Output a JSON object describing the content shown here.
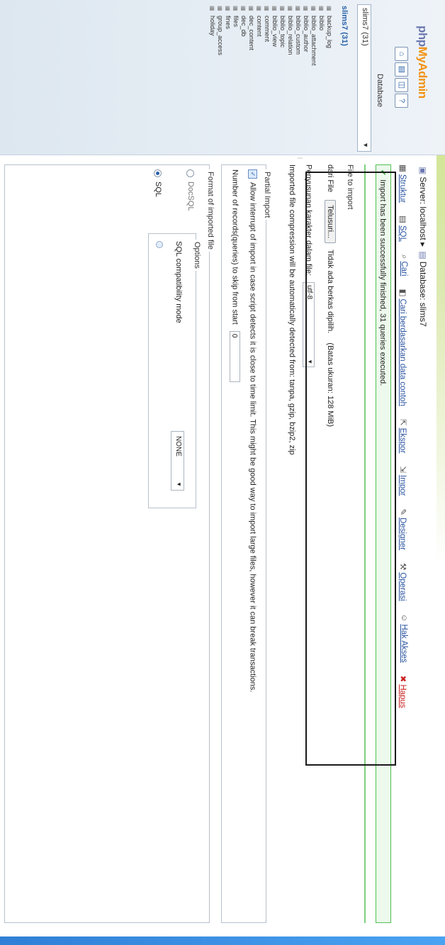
{
  "nav": {
    "logo": {
      "php": "php",
      "my": "My",
      "admin": "Admin"
    },
    "icons": [
      "home-icon",
      "sql-window-icon",
      "query-icon",
      "docs-icon"
    ],
    "db_label": "Database",
    "db_select_value": "slims7 (31)",
    "db_name": "slims7 (31)",
    "tables": [
      "backup_log",
      "biblio",
      "biblio_attachment",
      "biblio_author",
      "biblio_custom",
      "biblio_relation",
      "biblio_topic",
      "biblio_view",
      "comment",
      "content",
      "dec_content",
      "dec_db",
      "files",
      "fines",
      "group_access",
      "holiday"
    ]
  },
  "breadcrumb": {
    "server": "Server: localhost",
    "database": "Database: slims7"
  },
  "tabs": [
    "Struktur",
    "SQL",
    "Cari",
    "Cari berdasarkan data contoh",
    "Ekspor",
    "Impor",
    "Designer",
    "Operasi",
    "Hak Akses",
    "Hapus"
  ],
  "notice": "Import has been successfully finished, 31 queries executed.",
  "file_section": {
    "title": "File to import",
    "file_prefix": "dari File",
    "browse_label": "Telusuri...",
    "no_file": "Tidak ada berkas dipilih.",
    "max_size": "(Batas ukuran: 128 MiB)",
    "charset_label": "Penyusunan karakter dalam file:",
    "charset_value": "utf-8",
    "compression_note": "Imported file compression will be automatically detected from: tanpa, gzip, bzip2, zip"
  },
  "partial_import": {
    "legend": "Partial Import",
    "allow_interrupt": "Allow interrupt of import in case script detects it is close to time limit. This might be good way to import large files, however it can break transactions.",
    "skip_label": "Number of records(queries) to skip from start",
    "skip_value": "0"
  },
  "format": {
    "legend": "Format of imported file",
    "options": [
      "DocSQL",
      "SQL"
    ],
    "selected": "SQL",
    "options_legend": "Options",
    "compat_label": "SQL compatibility mode",
    "compat_value": "NONE"
  },
  "colors": {
    "accent": "#2a54a0",
    "success_border": "#4fc04f",
    "danger": "#c82020"
  }
}
